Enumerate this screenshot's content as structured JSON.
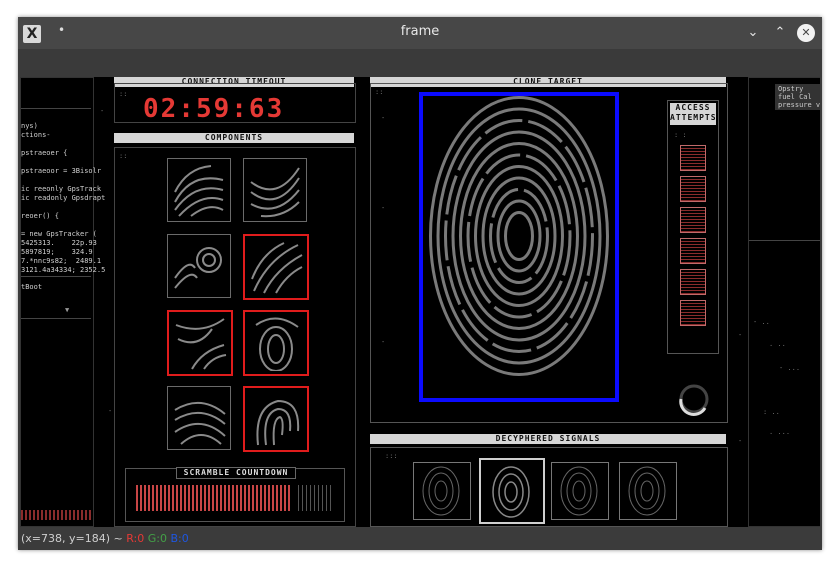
{
  "window": {
    "title": "frame",
    "app_icon_glyph": "X",
    "pin_glyph": "•",
    "controls": {
      "minimize": "⌄",
      "maximize": "⌃",
      "close": "✕"
    }
  },
  "left_code": {
    "lines": [
      "nys)",
      "ctions-",
      "",
      "pstraeoer {",
      "",
      "pstraeoor = 3Bisolr",
      "",
      "ic reeonly GpsTrack",
      "ic readonly Gpsdrapt",
      "",
      "reoer() {",
      "",
      "= new GpsTracker (",
      "5425313.    22p.93",
      "5897819;    324.9",
      "7.*nnc9s82;  2489.1",
      "3121.4a34334; 2352.5"
    ],
    "label": "tBoot",
    "label_right": "AV",
    "dropdown_glyph": "▼"
  },
  "connection_panel": {
    "header": "CONNECTION TIMEOUT",
    "countdown": "02:59:63"
  },
  "components_panel": {
    "header": "COMPONENTS"
  },
  "scramble_panel": {
    "header": "SCRAMBLE COUNTDOWN"
  },
  "clone_panel": {
    "header": "CLONE TARGET"
  },
  "attempts_panel": {
    "header_line1": "ACCESS",
    "header_line2": "ATTEMPTS"
  },
  "signals_panel": {
    "header": "DECYPHERED SIGNALS"
  },
  "right_popup": {
    "lines": [
      "Opstry",
      "fuel Cal",
      "pressure vol"
    ]
  },
  "colors": {
    "accent_red": "#e01c1c",
    "target_blue": "#0b0bff",
    "countdown_red": "#e53935"
  },
  "statusbar": {
    "coords": "(x=738, y=184) ~",
    "r": "R:0",
    "g": "G:0",
    "b": "B:0"
  }
}
